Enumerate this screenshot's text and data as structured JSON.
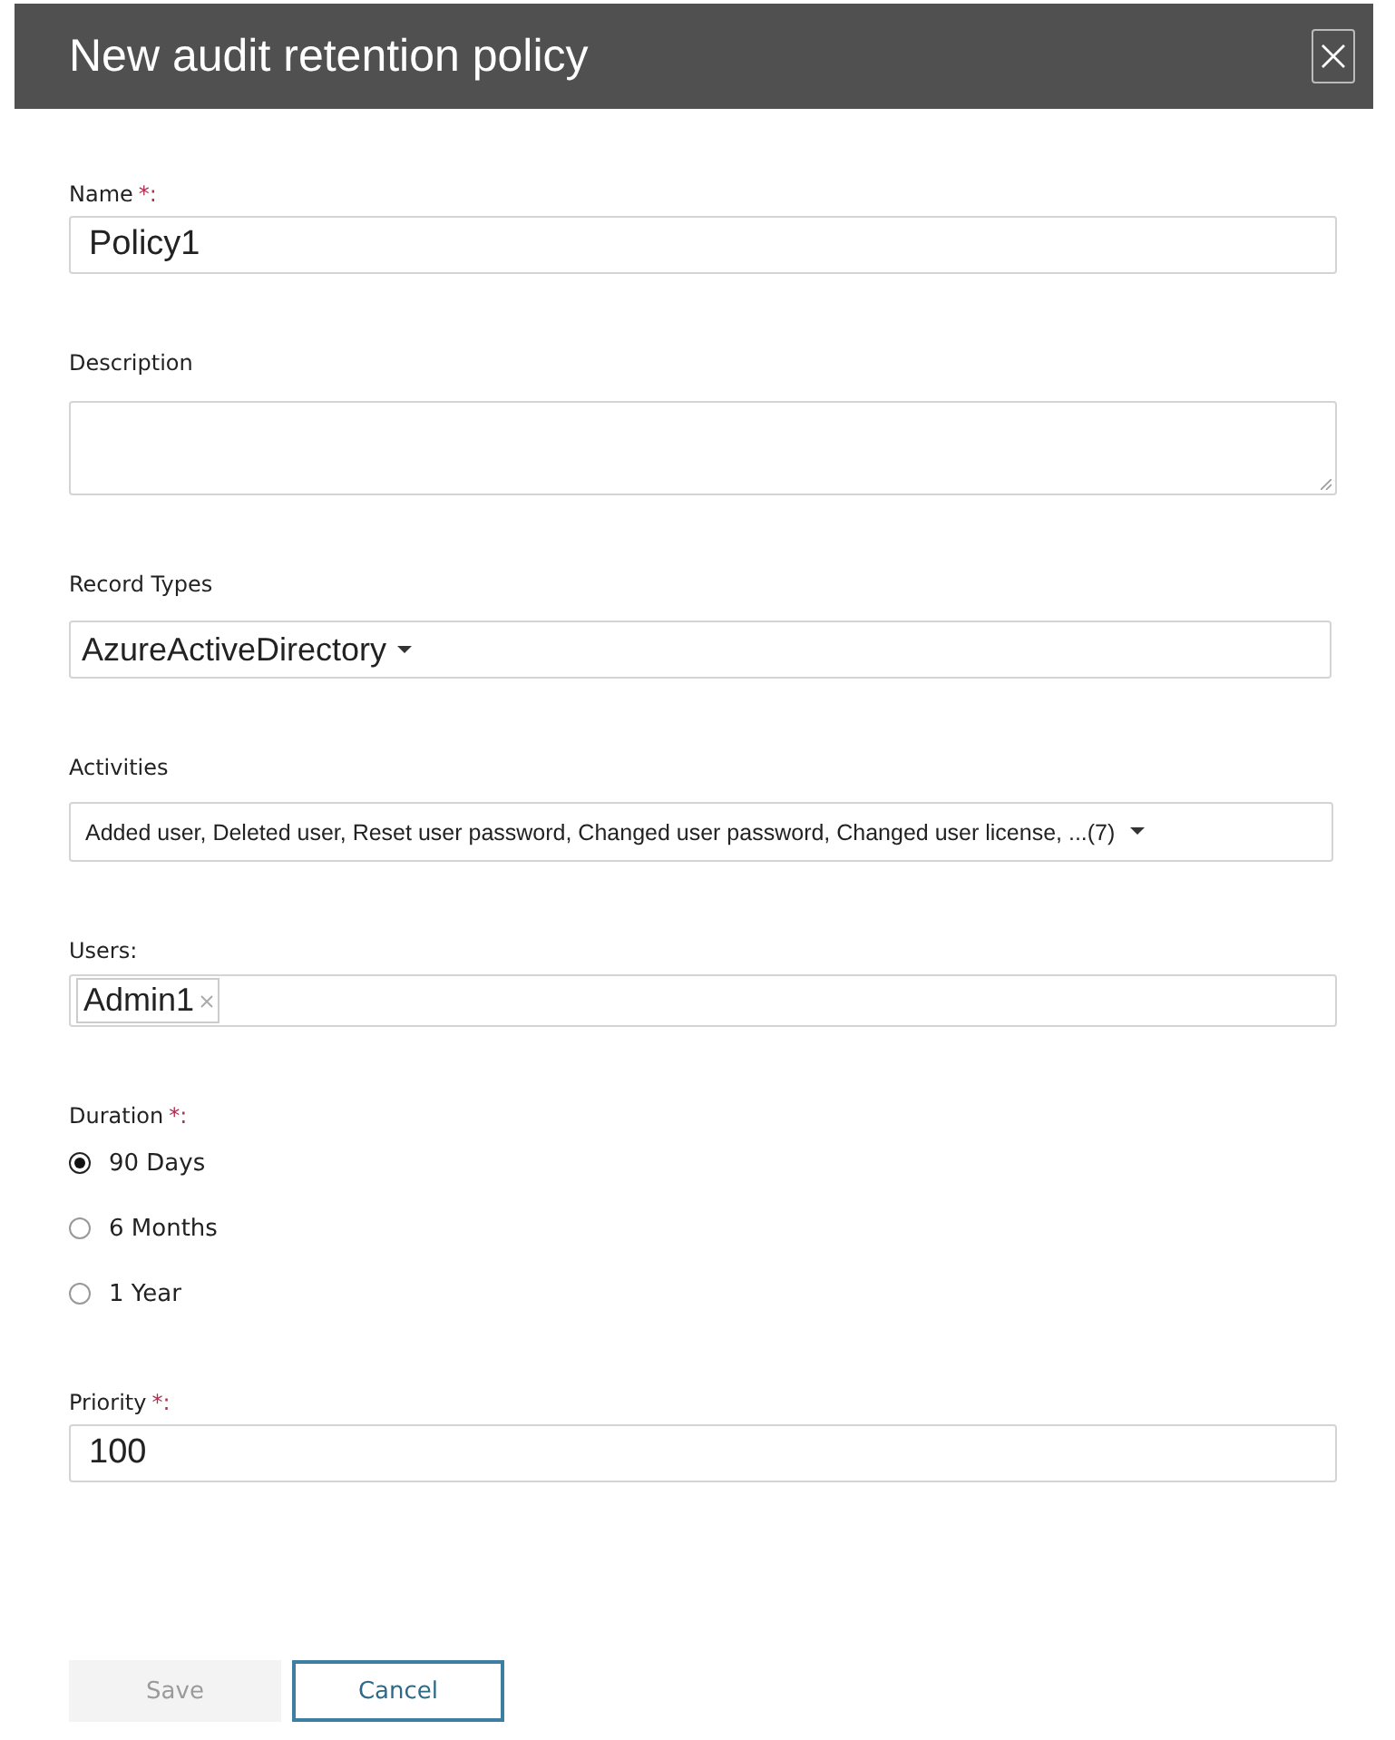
{
  "dialog": {
    "title": "New audit retention policy"
  },
  "fields": [
    {
      "kind": "text",
      "label": "Name",
      "required_mark": "*:",
      "value": "Policy1"
    },
    {
      "kind": "textarea",
      "label": "Description"
    },
    {
      "kind": "dropdown",
      "label": "Record Types",
      "value": "AzureActiveDirectory"
    },
    {
      "kind": "dropdown-small",
      "label": "Activities",
      "value": "Added user, Deleted user, Reset user password, Changed user password, Changed user license, ...(7)"
    },
    {
      "kind": "tags",
      "label": "Users:",
      "tags": [
        "Admin1"
      ]
    },
    {
      "kind": "radio",
      "label": "Duration",
      "required_mark": "*:",
      "options": [
        {
          "label": "90 Days",
          "selected": true
        },
        {
          "label": "6 Months",
          "selected": false
        },
        {
          "label": "1 Year",
          "selected": false
        }
      ]
    },
    {
      "kind": "text",
      "label": "Priority",
      "required_mark": "*:",
      "value": "100"
    }
  ],
  "buttons": [
    {
      "label": "Save",
      "disabled": true
    },
    {
      "label": "Cancel",
      "disabled": false
    }
  ]
}
